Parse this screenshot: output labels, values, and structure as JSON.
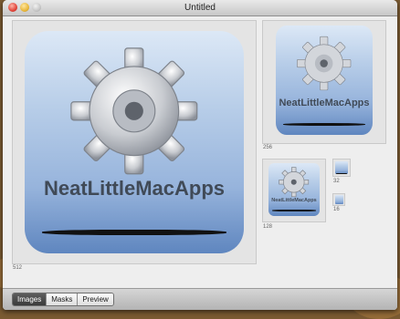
{
  "window": {
    "title": "Untitled"
  },
  "icon": {
    "brand_text": "NeatLittleMacApps"
  },
  "previews": [
    {
      "size_label": "512"
    },
    {
      "size_label": "256"
    },
    {
      "size_label": "128"
    },
    {
      "size_label": "32"
    },
    {
      "size_label": "16"
    }
  ],
  "bottom_bar": {
    "tabs": [
      {
        "label": "Images",
        "selected": true
      },
      {
        "label": "Masks",
        "selected": false
      },
      {
        "label": "Preview",
        "selected": false
      }
    ]
  }
}
